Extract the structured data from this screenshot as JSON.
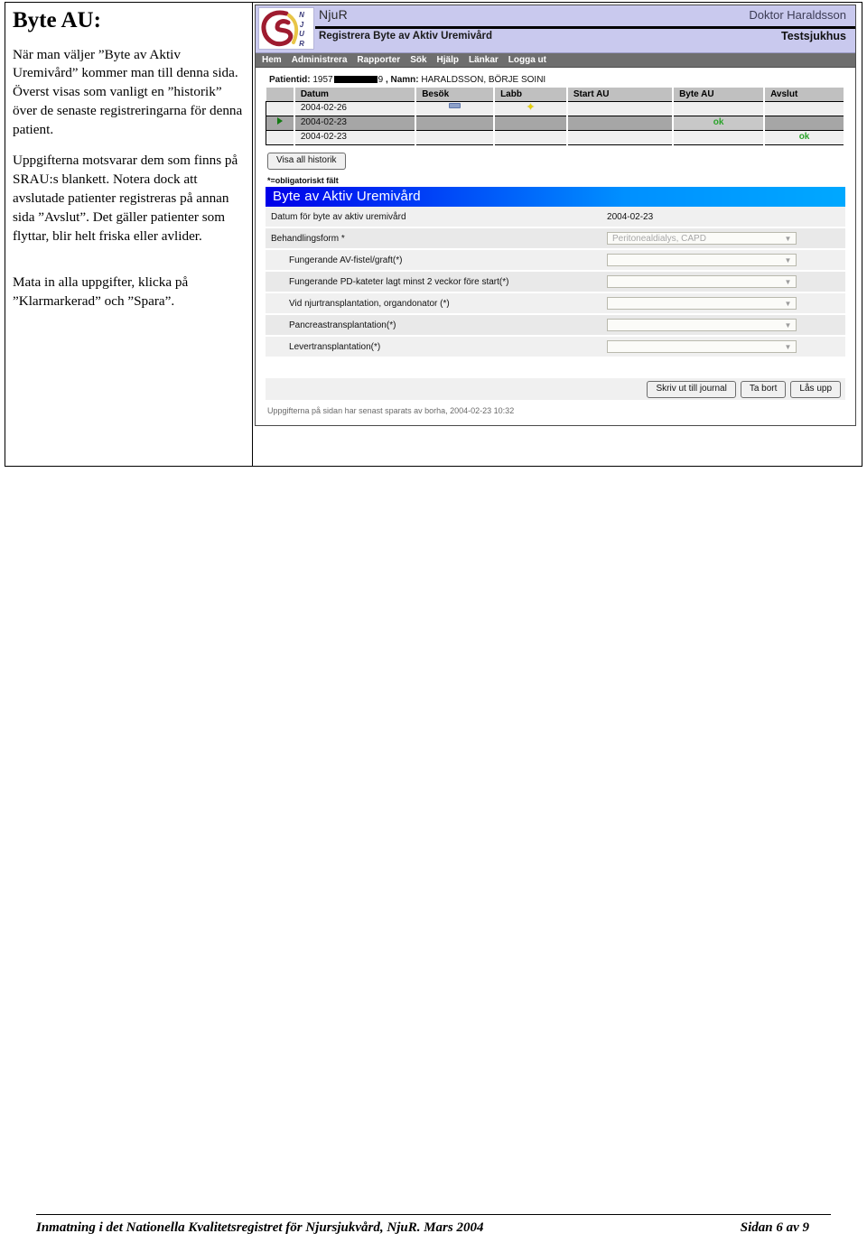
{
  "document": {
    "title": "Byte AU:",
    "paragraphs": [
      "När man väljer ”Byte av Aktiv Uremivård” kommer man till denna sida. Överst visas som vanligt en ”historik” över de senaste registreringarna för denna patient.",
      "Uppgifterna motsvarar dem som finns på SRAU:s blankett. Notera dock att avslutade patienter registreras på annan sida ”Avslut”. Det gäller patienter som flyttar, blir helt friska eller avlider.",
      "Mata in alla uppgifter, klicka på ”Klarmarkerad” och ”Spara”."
    ]
  },
  "footer": {
    "left": "Inmatning i det Nationella Kvalitetsregistret för Njursjukvård, NjuR.  Mars 2004",
    "right": "Sidan 6 av 9"
  },
  "app": {
    "brand": "NjuR",
    "logo_letters": "N\nJ\nU\nR",
    "page_heading": "Registrera Byte av Aktiv Uremivård",
    "user": "Doktor Haraldsson",
    "hospital": "Testsjukhus",
    "menu": [
      {
        "label": "Hem"
      },
      {
        "label": "Administrera"
      },
      {
        "label": "Rapporter"
      },
      {
        "label": "Sök"
      },
      {
        "label": "Hjälp"
      },
      {
        "label": "Länkar"
      },
      {
        "label": "Logga ut"
      }
    ],
    "patient": {
      "id_prefix": "Patientid:",
      "id_value_start": "1957",
      "id_value_end": "9",
      "name_prefix": ", Namn:",
      "name_value": "HARALDSSON, BÖRJE SOINI"
    },
    "history": {
      "columns": [
        "",
        "Datum",
        "Besök",
        "Labb",
        "Start AU",
        "Byte AU",
        "Avslut"
      ],
      "rows": [
        {
          "marker": "",
          "datum": "2004-02-26",
          "besok": "dash-icon",
          "labb": "star-icon",
          "start_au": "",
          "byte_au": "",
          "avslut": "",
          "selected": false
        },
        {
          "marker": "play-triangle",
          "datum": "2004-02-23",
          "besok": "",
          "labb": "",
          "start_au": "",
          "byte_au": "ok",
          "avslut": "",
          "selected": true
        },
        {
          "marker": "",
          "datum": "2004-02-23",
          "besok": "",
          "labb": "",
          "start_au": "",
          "byte_au": "",
          "avslut": "ok",
          "selected": false
        }
      ],
      "show_all_button": "Visa all historik"
    },
    "required_note": "*=obligatoriskt fält",
    "section_title": "Byte av Aktiv Uremivård",
    "form_rows": [
      {
        "label": "Datum för byte av aktiv uremivård",
        "type": "text",
        "value": "2004-02-23",
        "indent": false
      },
      {
        "label": "Behandlingsform *",
        "type": "select",
        "value": "Peritonealdialys, CAPD",
        "indent": false
      },
      {
        "label": "Fungerande AV-fistel/graft(*)",
        "type": "select",
        "value": "",
        "indent": true
      },
      {
        "label": "Fungerande PD-kateter lagt minst 2 veckor före start(*)",
        "type": "select",
        "value": "",
        "indent": true
      },
      {
        "label": "Vid njurtransplantation, organdonator (*)",
        "type": "select",
        "value": "",
        "indent": true
      },
      {
        "label": "Pancreastransplantation(*)",
        "type": "select",
        "value": "",
        "indent": true
      },
      {
        "label": "Levertransplantation(*)",
        "type": "select",
        "value": "",
        "indent": true
      }
    ],
    "actions": [
      {
        "label": "Skriv ut till journal"
      },
      {
        "label": "Ta bort"
      },
      {
        "label": "Lås upp"
      }
    ],
    "saved_note": "Uppgifterna på sidan har senast sparats av borha, 2004-02-23 10:32"
  },
  "colors": {
    "banner": "#c9c9ee",
    "menu_bar": "#6e6e6e",
    "section_header_start": "#0000e8",
    "section_header_end": "#00a8ff",
    "ok_green": "#2aa32a",
    "logo_red": "#9e1b2f",
    "logo_gold": "#e8c547"
  }
}
